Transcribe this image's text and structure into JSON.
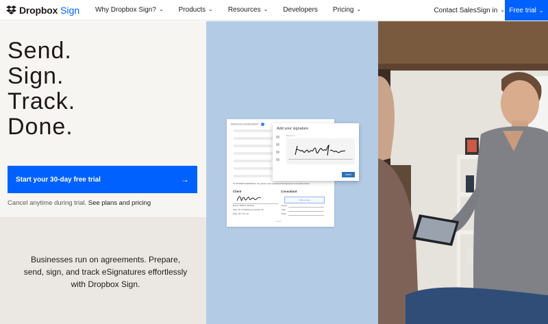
{
  "nav": {
    "brand": "Dropbox",
    "brand_sub": "Sign",
    "items": [
      {
        "label": "Why Dropbox Sign?",
        "chevron": true
      },
      {
        "label": "Products",
        "chevron": true
      },
      {
        "label": "Resources",
        "chevron": true
      },
      {
        "label": "Developers",
        "chevron": false
      },
      {
        "label": "Pricing",
        "chevron": true
      }
    ],
    "contact": "Contact Sales",
    "signin": "Sign in",
    "free_trial": "Free trial"
  },
  "hero": {
    "headline": [
      "Send.",
      "Sign.",
      "Track.",
      "Done."
    ],
    "cta": "Start your 30-day free trial",
    "cancel_text": "Cancel anytime during trial.",
    "plans_link": "See plans and pricing",
    "tagline": "Businesses run on agreements. Prepare, send, sign, and track eSignatures effortlessly with Dropbox Sign."
  },
  "document": {
    "header": "SERVICES AGREEMENT",
    "witness": "IN WITNESS WHEREOF, the parties have executed this Agreement as stated below.",
    "client_label": "Client",
    "consultant_label": "Consultant",
    "click_to_sign": "Click to sign",
    "name_value": "Name: William Jackson",
    "title_value": "Title: VP of Marketing, Harford Inc.",
    "date_value": "Date: 08 / 15 / 22",
    "name_label": "Name:",
    "title_label": "Title:",
    "date_label": "Date:",
    "page": "1 of 1"
  },
  "modal": {
    "title": "Add your signature",
    "draw_label": "Draw it in",
    "insert": "Insert"
  },
  "colors": {
    "accent": "#0061fe",
    "mid_panel": "#b4cbe6",
    "left_top": "#f7f5f2",
    "left_bottom": "#ebe8e3"
  }
}
